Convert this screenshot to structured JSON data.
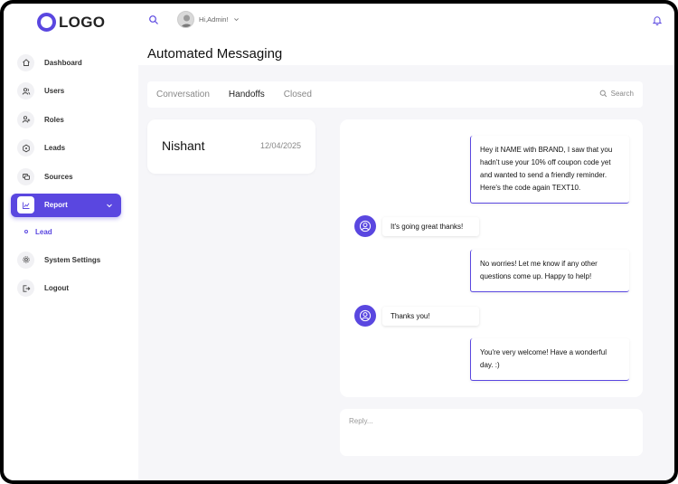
{
  "logo": {
    "text": "LOGO"
  },
  "header": {
    "greeting": "Hi,Admin!"
  },
  "page": {
    "title": "Automated Messaging"
  },
  "sidebar": {
    "items": [
      {
        "label": "Dashboard",
        "icon": "home-icon"
      },
      {
        "label": "Users",
        "icon": "users-icon"
      },
      {
        "label": "Roles",
        "icon": "user-plus-icon"
      },
      {
        "label": "Leads",
        "icon": "leads-icon"
      },
      {
        "label": "Sources",
        "icon": "sources-icon"
      },
      {
        "label": "Report",
        "icon": "report-icon",
        "active": true
      },
      {
        "label": "System Settings",
        "icon": "gear-icon"
      },
      {
        "label": "Logout",
        "icon": "logout-icon"
      }
    ],
    "sub_items": [
      {
        "label": "Lead"
      }
    ]
  },
  "tabs": [
    {
      "label": "Conversation"
    },
    {
      "label": "Handoffs",
      "active": true
    },
    {
      "label": "Closed"
    }
  ],
  "search": {
    "label": "Search"
  },
  "conversation": {
    "name": "Nishant",
    "date": "12/04/2025"
  },
  "messages": [
    {
      "direction": "out",
      "text": "Hey it NAME with BRAND, I saw that you hadn't use your 10% off coupon code yet and wanted to send a friendly reminder. Here's the code again TEXT10."
    },
    {
      "direction": "in",
      "text": "It's going great thanks!"
    },
    {
      "direction": "out",
      "text": "No worries! Let me know if any other questions come up. Happy to help!"
    },
    {
      "direction": "in",
      "text": "Thanks you!"
    },
    {
      "direction": "out",
      "text": "You're very welcome! Have a wonderful day. :)"
    }
  ],
  "reply": {
    "placeholder": "Reply..."
  },
  "colors": {
    "accent": "#5a47e0",
    "content_bg": "#f6f6f9"
  }
}
